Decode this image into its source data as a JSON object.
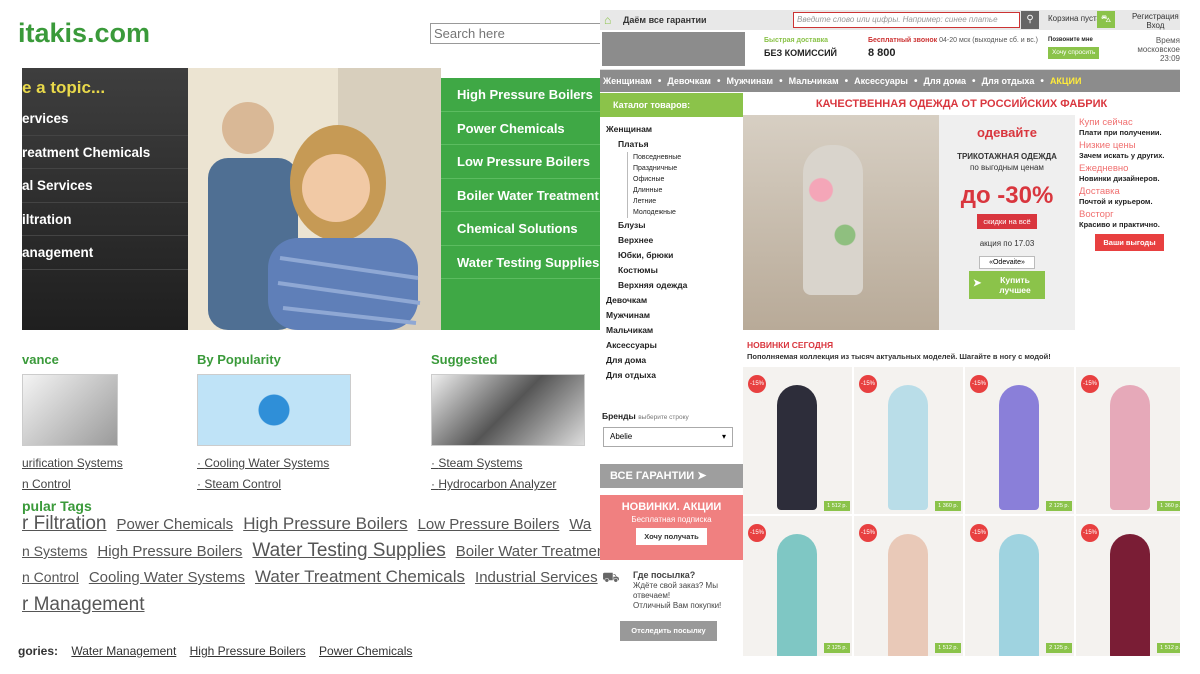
{
  "left": {
    "logo": "itakis.com",
    "search_placeholder": "Search here",
    "topic_heading": "e a topic...",
    "topic_items": [
      "ervices",
      "reatment Chemicals",
      "al Services",
      "iltration",
      "anagement"
    ],
    "green_items": [
      "High Pressure Boilers",
      "Power Chemicals",
      "Low Pressure Boilers",
      "Boiler Water Treatment",
      "Chemical Solutions",
      "Water Testing Supplies"
    ],
    "columns": [
      {
        "title": "vance",
        "links": [
          "urification Systems",
          "n Control"
        ]
      },
      {
        "title": "By Popularity",
        "links": [
          "Cooling Water Systems",
          "Steam Control"
        ]
      },
      {
        "title": "Suggested",
        "links": [
          "Steam Systems",
          "Hydrocarbon Analyzer"
        ]
      }
    ],
    "tags_heading": "pular Tags",
    "tag_rows": [
      [
        {
          "t": "r Filtration",
          "s": 19
        },
        {
          "t": "Power Chemicals",
          "s": 15
        },
        {
          "t": "High Pressure Boilers",
          "s": 17
        },
        {
          "t": "Low Pressure Boilers",
          "s": 15
        },
        {
          "t": "Wa",
          "s": 15
        }
      ],
      [
        {
          "t": "n Systems",
          "s": 14
        },
        {
          "t": "High Pressure Boilers",
          "s": 15
        },
        {
          "t": "Water Testing Supplies",
          "s": 19
        },
        {
          "t": "Boiler Water Treatment",
          "s": 15
        }
      ],
      [
        {
          "t": "n Control",
          "s": 14
        },
        {
          "t": "Cooling Water Systems",
          "s": 15
        },
        {
          "t": "Water Treatment Chemicals",
          "s": 17
        },
        {
          "t": "Industrial Services",
          "s": 15
        }
      ],
      [
        {
          "t": "r Management",
          "s": 19
        }
      ]
    ],
    "categories_label": "gories:",
    "categories": [
      "Water Management",
      "High Pressure Boilers",
      "Power Chemicals"
    ]
  },
  "right": {
    "guarantee": "Даём все гарантии",
    "search_placeholder": "Введите слово или цифры. Например: синее платье",
    "cart": "Корзина пуста",
    "register": "Регистрация",
    "login": "Вход",
    "fast_delivery": "Быстрая доставка",
    "no_fee": "БЕЗ КОМИССИЙ",
    "free_call": "Бесплатный звонок",
    "call_hours": "04-20 мск (выходные сб. и вс.)",
    "phone": "8 800",
    "callback_label": "Позвоните мне",
    "callback_button": "Хочу спросить",
    "time_label": "Время московское",
    "time": "23:09",
    "nav": [
      "Женщинам",
      "Девочкам",
      "Мужчинам",
      "Мальчикам",
      "Аксессуары",
      "Для дома",
      "Для отдыха"
    ],
    "nav_sale": "АКЦИИ",
    "catalog": "Каталог товаров:",
    "tree": {
      "women": "Женщинам",
      "dresses": "Платья",
      "dress_sub": [
        "Повседневные",
        "Праздничные",
        "Офисные",
        "Длинные",
        "Летние",
        "Молодежные"
      ],
      "women_sub": [
        "Блузы",
        "Верхнее",
        "Юбки, брюки",
        "Костюмы",
        "Верхняя одежда"
      ],
      "top": [
        "Девочкам",
        "Мужчинам",
        "Мальчикам",
        "Аксессуары",
        "Для дома",
        "Для отдыха"
      ]
    },
    "brands": "Бренды",
    "brands_hint": "выберите строку",
    "brand_value": "Abelie",
    "all_guarantees": "ВСЕ ГАРАНТИИ",
    "news_title": "НОВИНКИ. АКЦИИ",
    "news_sub": "Бесплатная подписка",
    "news_button": "Хочу получать",
    "parcel_q": "Где посылка?",
    "parcel_text": "Ждёте свой заказ? Мы отвечаем!",
    "parcel_text2": "Отличный Вам покупки!",
    "track_button": "Отследить посылку",
    "quality": "КАЧЕСТВЕННАЯ ОДЕЖДА ОТ РОССИЙСКИХ ФАБРИК",
    "promo": {
      "brand": "одевайте",
      "knit": "ТРИКОТАЖНАЯ ОДЕЖДА",
      "price": "по выгодным ценам",
      "percent": "до -30%",
      "discount": "скидки на всё",
      "until": "акция по 17.03",
      "brand_tag": "«Odevaite»",
      "buy": "Купить лучшее"
    },
    "features": [
      {
        "t": "Купи сейчас",
        "s": "Плати при получении."
      },
      {
        "t": "Низкие цены",
        "s": "Зачем искать у других."
      },
      {
        "t": "Ежедневно",
        "s": "Новинки дизайнеров."
      },
      {
        "t": "Доставка",
        "s": "Почтой и курьером."
      },
      {
        "t": "Восторг",
        "s": "Красиво и практично."
      }
    ],
    "benefit_button": "Ваши выгоды",
    "new_today": "НОВИНКИ СЕГОДНЯ",
    "new_sub": "Пополняемая коллекция из тысяч актуальных моделей. Шагайте в ногу с модой!",
    "products": [
      {
        "d": "-15%",
        "p": "1 512 р.",
        "c": "#2d2d3a"
      },
      {
        "d": "-15%",
        "p": "1 360 р.",
        "c": "#b9dde8"
      },
      {
        "d": "-15%",
        "p": "2 125 р.",
        "c": "#8a7fd9"
      },
      {
        "d": "-15%",
        "p": "1 360 р.",
        "c": "#e6a9b9"
      },
      {
        "d": "-15%",
        "p": "2 125 р.",
        "c": "#7fc7c4"
      },
      {
        "d": "-15%",
        "p": "1 512 р.",
        "c": "#e9c9b8"
      },
      {
        "d": "-15%",
        "p": "2 125 р.",
        "c": "#9fd3e0"
      },
      {
        "d": "-15%",
        "p": "1 512 р.",
        "c": "#7a1d35"
      }
    ]
  }
}
